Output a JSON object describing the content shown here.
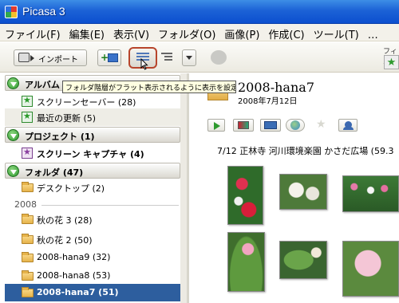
{
  "window": {
    "title": "Picasa 3"
  },
  "menu": [
    "ファイル(F)",
    "編集(E)",
    "表示(V)",
    "フォルダ(O)",
    "画像(P)",
    "作成(C)",
    "ツール(T)",
    "…"
  ],
  "toolbar": {
    "import_label": "インポート",
    "filter_label": "フィル"
  },
  "tooltip": "フォルダ階層がフラット表示されるように表示を設定",
  "sidebar": {
    "albums_header": "アルバム (2)",
    "albums": [
      {
        "label": "スクリーンセーバー (28)"
      },
      {
        "label": "最近の更新 (5)"
      }
    ],
    "projects_header": "プロジェクト (1)",
    "projects": [
      {
        "label": "スクリーン キャプチャ (4)"
      }
    ],
    "folders_header": "フォルダ (47)",
    "folders_top": [
      {
        "label": "デスクトップ (2)"
      }
    ],
    "year": "2008",
    "folders_2008": [
      {
        "label": "秋の花 3 (28)"
      },
      {
        "label": "秋の花 2 (50)"
      },
      {
        "label": "2008-hana9 (32)"
      },
      {
        "label": "2008-hana8 (53)"
      },
      {
        "label": "2008-hana7 (51)"
      }
    ]
  },
  "folder": {
    "title": "2008-hana7",
    "date": "2008年7月12日",
    "caption": "7/12 正林寺 河川環境楽園 かさだ広場 (59.3"
  },
  "colors": {
    "title_bar": "#1c62d6",
    "selected_folder": "#2d5e9e",
    "highlight_border": "#b7452c",
    "section_toggle": "#2e9a2e"
  }
}
